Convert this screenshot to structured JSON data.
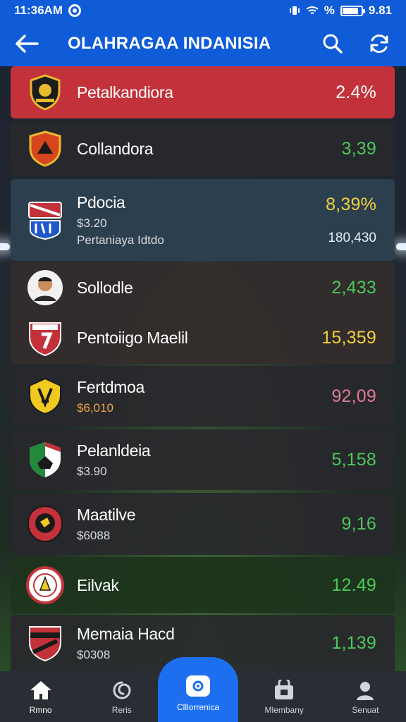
{
  "status_bar": {
    "time": "11:36AM",
    "battery_text": "%",
    "signal_text": "9.81"
  },
  "app_bar": {
    "title": "OLAHRAGAA INDANISIA",
    "back_icon": "arrow-left-icon",
    "search_icon": "search-icon",
    "refresh_icon": "refresh-icon"
  },
  "colors": {
    "primary": "#0f5bd8",
    "highlight_row": "#c3323a",
    "green_value": "#4cc85a",
    "yellow_value": "#f2d23c",
    "pink_value": "#e07a96"
  },
  "teams": [
    {
      "name": "Petalkandiora",
      "sub": "",
      "value": "2.4%",
      "value_color": "#ffffff",
      "logo_icon": "crest-icon"
    },
    {
      "name": "Collandora",
      "sub": "",
      "value": "3,39",
      "value_color": "#4cc85a",
      "logo_icon": "shield-icon"
    },
    {
      "name": "Pdocia",
      "sub": "$3.20",
      "sub2": "Pertaniaya Idtdo",
      "value": "8,39%",
      "value2": "180,430",
      "value_color": "#f2d23c",
      "logo_icon": "flag-shield-icon"
    },
    {
      "name": "Sollodle",
      "sub": "",
      "value": "2,433",
      "value_color": "#4cc85a",
      "logo_icon": "player-avatar-icon"
    },
    {
      "name": "Pentoiigo Maelil",
      "sub": "",
      "value": "15,359",
      "value_color": "#f2d23c",
      "logo_icon": "number-shield-icon"
    },
    {
      "name": "Fertdmoa",
      "sub": "$6,010",
      "value": "92,09",
      "value_color": "#e07a96",
      "logo_icon": "yellow-shield-icon"
    },
    {
      "name": "Pelanldeia",
      "sub": "$3.90",
      "value": "5,158",
      "value_color": "#4cc85a",
      "logo_icon": "green-shield-icon"
    },
    {
      "name": "Maatilve",
      "sub": "$6088",
      "value": "9,16",
      "value_color": "#4cc85a",
      "logo_icon": "eagle-badge-icon"
    },
    {
      "name": "Eilvak",
      "sub": "",
      "value": "12.49",
      "value_color": "#4cc85a",
      "logo_icon": "round-badge-icon"
    },
    {
      "name": "Memaia Hacd",
      "sub": "$0308",
      "value": "1,139",
      "value_color": "#4cc85a",
      "logo_icon": "stripe-shield-icon"
    }
  ],
  "bottom_nav": [
    {
      "label": "Rmno",
      "icon": "home-icon"
    },
    {
      "label": "Reris",
      "icon": "swirl-icon"
    },
    {
      "label": "Clllorrenica",
      "icon": "chat-icon",
      "active": true
    },
    {
      "label": "Mlembany",
      "icon": "store-icon"
    },
    {
      "label": "Senuat",
      "icon": "profile-icon"
    }
  ]
}
